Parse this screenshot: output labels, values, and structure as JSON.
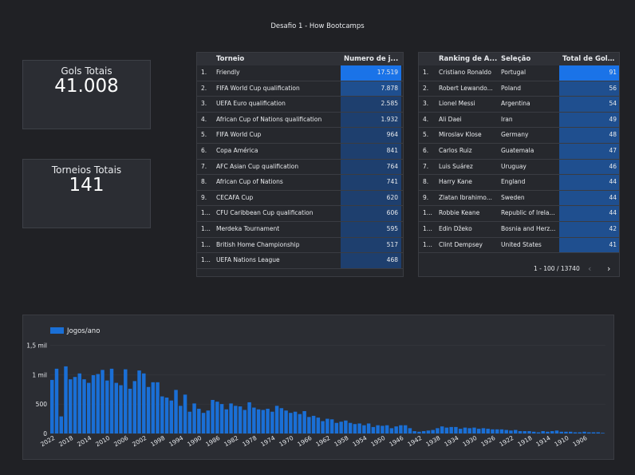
{
  "title": "Desafio 1 - How Bootcamps",
  "cards": {
    "gols": {
      "label": "Gols Totais",
      "value": "41.008"
    },
    "torneios": {
      "label": "Torneios Totais",
      "value": "141"
    }
  },
  "tournaments": {
    "headers": [
      "Torneio",
      "Numero de j..."
    ],
    "rows": [
      {
        "rank": "1.",
        "name": "Friendly",
        "value": "17.519",
        "n": 17519
      },
      {
        "rank": "2.",
        "name": "FIFA World Cup qualification",
        "value": "7.878",
        "n": 7878
      },
      {
        "rank": "3.",
        "name": "UEFA Euro qualification",
        "value": "2.585",
        "n": 2585
      },
      {
        "rank": "4.",
        "name": "African Cup of Nations qualification",
        "value": "1.932",
        "n": 1932
      },
      {
        "rank": "5.",
        "name": "FIFA World Cup",
        "value": "964",
        "n": 964
      },
      {
        "rank": "6.",
        "name": "Copa América",
        "value": "841",
        "n": 841
      },
      {
        "rank": "7.",
        "name": "AFC Asian Cup qualification",
        "value": "764",
        "n": 764
      },
      {
        "rank": "8.",
        "name": "African Cup of Nations",
        "value": "741",
        "n": 741
      },
      {
        "rank": "9.",
        "name": "CECAFA Cup",
        "value": "620",
        "n": 620
      },
      {
        "rank": "1...",
        "name": "CFU Caribbean Cup qualification",
        "value": "606",
        "n": 606
      },
      {
        "rank": "1...",
        "name": "Merdeka Tournament",
        "value": "595",
        "n": 595
      },
      {
        "rank": "1...",
        "name": "British Home Championship",
        "value": "517",
        "n": 517
      },
      {
        "rank": "1...",
        "name": "UEFA Nations League",
        "value": "468",
        "n": 468
      }
    ]
  },
  "scorers": {
    "headers": [
      "Ranking de A...",
      "Seleção",
      "Total de Gols..."
    ],
    "rows": [
      {
        "rank": "1.",
        "name": "Cristiano Ronaldo",
        "team": "Portugal",
        "value": "91",
        "n": 91
      },
      {
        "rank": "2.",
        "name": "Robert Lewando...",
        "team": "Poland",
        "value": "56",
        "n": 56
      },
      {
        "rank": "3.",
        "name": "Lionel Messi",
        "team": "Argentina",
        "value": "54",
        "n": 54
      },
      {
        "rank": "4.",
        "name": "Ali Daei",
        "team": "Iran",
        "value": "49",
        "n": 49
      },
      {
        "rank": "5.",
        "name": "Miroslav Klose",
        "team": "Germany",
        "value": "48",
        "n": 48
      },
      {
        "rank": "6.",
        "name": "Carlos Ruiz",
        "team": "Guatemala",
        "value": "47",
        "n": 47
      },
      {
        "rank": "7.",
        "name": "Luis Suárez",
        "team": "Uruguay",
        "value": "46",
        "n": 46
      },
      {
        "rank": "8.",
        "name": "Harry Kane",
        "team": "England",
        "value": "44",
        "n": 44
      },
      {
        "rank": "9.",
        "name": "Zlatan Ibrahimo...",
        "team": "Sweden",
        "value": "44",
        "n": 44
      },
      {
        "rank": "1...",
        "name": "Robbie Keane",
        "team": "Republic of Irela...",
        "value": "44",
        "n": 44
      },
      {
        "rank": "1...",
        "name": "Edin Džeko",
        "team": "Bosnia and Herz...",
        "value": "42",
        "n": 42
      },
      {
        "rank": "1...",
        "name": "Clint Dempsey",
        "team": "United States",
        "value": "41",
        "n": 41
      }
    ],
    "pager": "1 - 100 / 13740"
  },
  "colors": {
    "bar": "#1a6fd6",
    "highlight": "#1a73e8",
    "cell_strong": "#1f4f8f",
    "cell_weak": "#1e3f6e"
  },
  "chart_data": {
    "type": "bar",
    "legend": "Jogos/ano",
    "ylim": [
      0,
      1600
    ],
    "yticks": [
      0,
      500,
      1000,
      1500
    ],
    "ytick_labels": [
      "0",
      "500",
      "1 mil",
      "1,5 mil"
    ],
    "x": [
      2022,
      2021,
      2020,
      2019,
      2018,
      2017,
      2016,
      2015,
      2014,
      2013,
      2012,
      2011,
      2010,
      2009,
      2008,
      2007,
      2006,
      2005,
      2004,
      2003,
      2002,
      2001,
      2000,
      1999,
      1998,
      1997,
      1996,
      1995,
      1994,
      1993,
      1992,
      1991,
      1990,
      1989,
      1988,
      1987,
      1986,
      1985,
      1984,
      1983,
      1982,
      1981,
      1980,
      1979,
      1978,
      1977,
      1976,
      1975,
      1974,
      1973,
      1972,
      1971,
      1970,
      1969,
      1968,
      1967,
      1966,
      1965,
      1964,
      1963,
      1962,
      1961,
      1960,
      1959,
      1958,
      1957,
      1956,
      1955,
      1954,
      1953,
      1952,
      1951,
      1950,
      1949,
      1948,
      1947,
      1946,
      1945,
      1944,
      1943,
      1942,
      1941,
      1940,
      1939,
      1938,
      1937,
      1936,
      1935,
      1934,
      1933,
      1932,
      1931,
      1930,
      1929,
      1928,
      1927,
      1926,
      1925,
      1924,
      1923,
      1922,
      1921,
      1920,
      1919,
      1918,
      1917,
      1916,
      1915,
      1914,
      1913,
      1912,
      1911,
      1910,
      1909,
      1908,
      1907,
      1906,
      1905,
      1904,
      1903,
      1902
    ],
    "xtick_labels": [
      "2022",
      "2018",
      "2014",
      "2010",
      "2006",
      "2002",
      "1998",
      "1994",
      "1990",
      "1986",
      "1982",
      "1978",
      "1974",
      "1970",
      "1966",
      "1962",
      "1958",
      "1954",
      "1950",
      "1946",
      "1942",
      "1938",
      "1934",
      "1930",
      "1926",
      "1922",
      "1918",
      "1914",
      "1910",
      "1906"
    ],
    "values": [
      910,
      1100,
      290,
      1140,
      920,
      960,
      1020,
      920,
      860,
      990,
      1010,
      1080,
      900,
      1100,
      860,
      820,
      1090,
      760,
      890,
      1070,
      1020,
      790,
      870,
      870,
      630,
      610,
      560,
      740,
      470,
      660,
      370,
      510,
      420,
      350,
      390,
      570,
      540,
      500,
      410,
      510,
      470,
      460,
      400,
      530,
      440,
      410,
      400,
      420,
      370,
      470,
      430,
      390,
      350,
      370,
      330,
      380,
      280,
      300,
      270,
      210,
      250,
      240,
      180,
      200,
      220,
      180,
      160,
      170,
      140,
      170,
      110,
      140,
      130,
      140,
      90,
      120,
      140,
      140,
      90,
      40,
      30,
      40,
      50,
      60,
      90,
      120,
      100,
      110,
      110,
      80,
      100,
      90,
      100,
      80,
      90,
      80,
      70,
      70,
      70,
      60,
      50,
      60,
      40,
      40,
      40,
      30,
      20,
      40,
      30,
      40,
      50,
      30,
      30,
      30,
      20,
      20,
      30,
      20,
      20,
      20,
      10
    ]
  }
}
